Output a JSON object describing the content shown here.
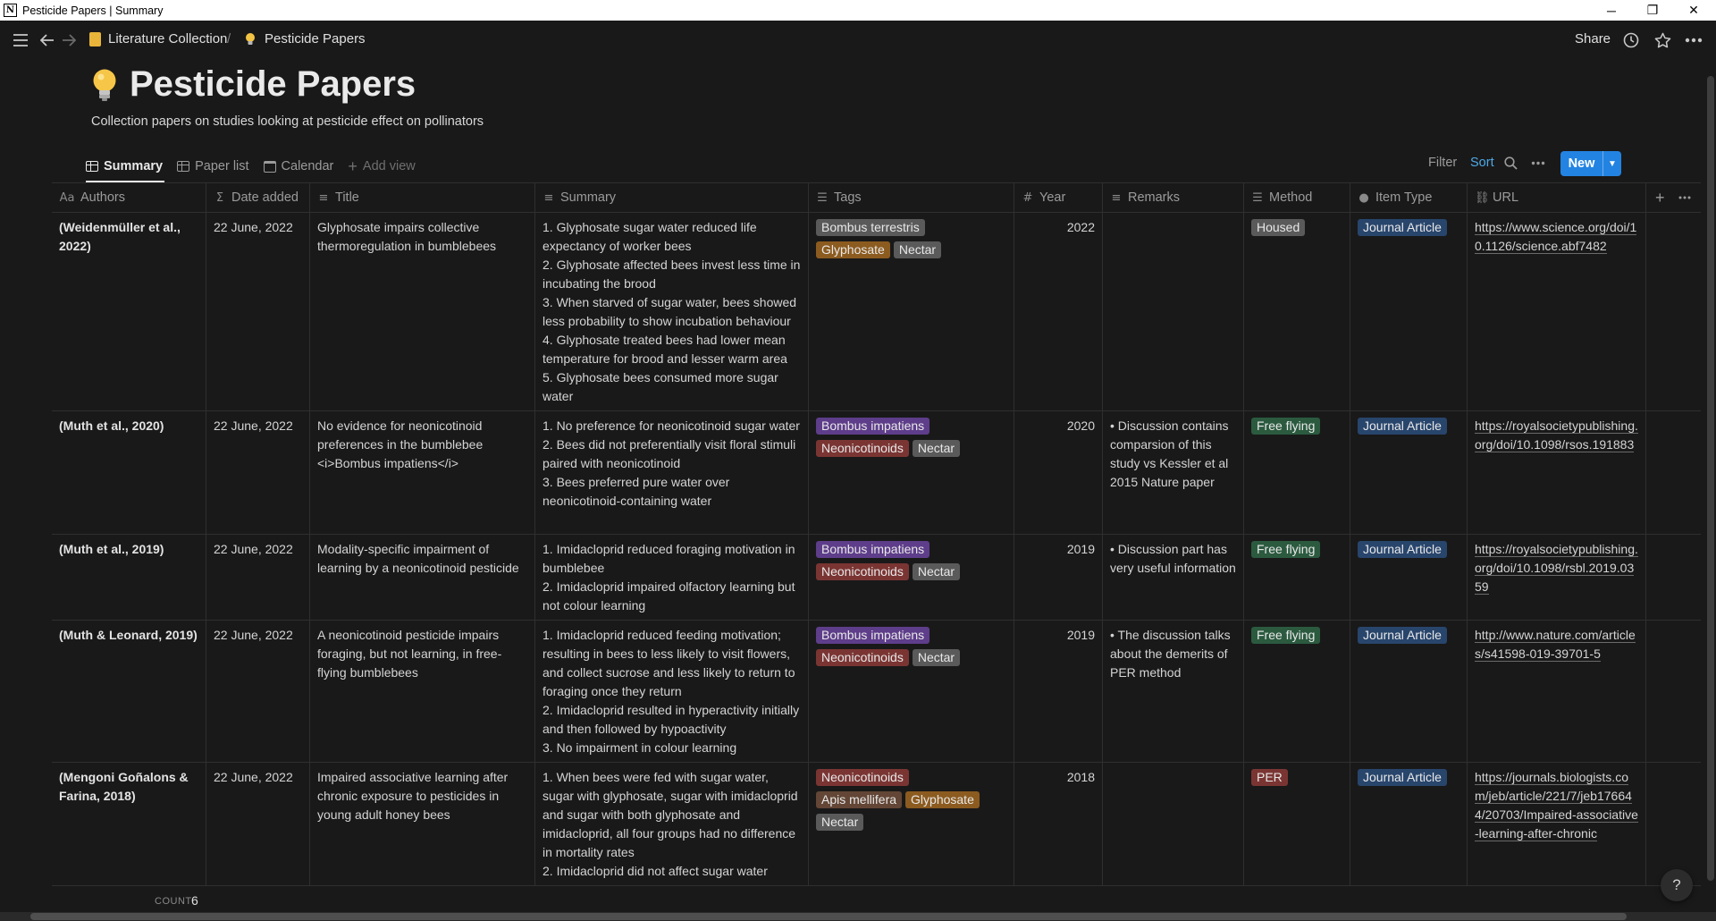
{
  "window": {
    "title": "Pesticide Papers | Summary",
    "app_logo": "N"
  },
  "breadcrumb": {
    "parent": "Literature Collection",
    "separator": "/",
    "current": "Pesticide Papers"
  },
  "topbar": {
    "share_label": "Share"
  },
  "page": {
    "title": "Pesticide Papers",
    "description": "Collection papers on studies looking at pesticide effect on pollinators"
  },
  "views": {
    "tabs": [
      {
        "label": "Summary",
        "icon": "table-icon",
        "active": true
      },
      {
        "label": "Paper list",
        "icon": "table-icon",
        "active": false
      },
      {
        "label": "Calendar",
        "icon": "calendar-icon",
        "active": false
      }
    ],
    "add_view_label": "Add view"
  },
  "toolbar": {
    "filter_label": "Filter",
    "sort_label": "Sort",
    "new_label": "New"
  },
  "columns": [
    {
      "label": "Authors",
      "icon": "Aa"
    },
    {
      "label": "Date added",
      "icon": "Σ"
    },
    {
      "label": "Title",
      "icon": "≡"
    },
    {
      "label": "Summary",
      "icon": "≡"
    },
    {
      "label": "Tags",
      "icon": "☰"
    },
    {
      "label": "Year",
      "icon": "#"
    },
    {
      "label": "Remarks",
      "icon": "≡"
    },
    {
      "label": "Method",
      "icon": "☰"
    },
    {
      "label": "Item Type",
      "icon": "●"
    },
    {
      "label": "URL",
      "icon": "⛓"
    }
  ],
  "tag_colors": {
    "gray": "#5a5a5a",
    "orange": "#8c5b1f",
    "purple": "#5e3d8a",
    "red": "#7a3533",
    "green": "#2b5a3f",
    "blue": "#28456c",
    "brown": "#634636"
  },
  "rows": [
    {
      "authors": "(Weidenmüller et al., 2022)",
      "date": "22 June, 2022",
      "title": "Glyphosate impairs collective thermoregulation in bumblebees",
      "summary": [
        "1. Glyphosate sugar water reduced life expectancy of worker bees",
        "2. Glyphosate affected bees invest less time in incubating the brood",
        "3. When starved of sugar water, bees showed less probability to show incubation behaviour",
        "4. Glyphosate treated bees had lower mean temperature for brood and lesser warm area",
        "5. Glyphosate bees consumed more sugar water"
      ],
      "tags": [
        {
          "label": "Bombus terrestris",
          "color": "gray"
        },
        {
          "label": "Glyphosate",
          "color": "orange"
        },
        {
          "label": "Nectar",
          "color": "gray"
        }
      ],
      "year": "2022",
      "remarks": "",
      "method": {
        "label": "Housed",
        "color": "gray"
      },
      "item_type": {
        "label": "Journal Article",
        "color": "blue"
      },
      "url": "https://www.science.org/doi/10.1126/science.abf7482"
    },
    {
      "authors": "(Muth et al., 2020)",
      "date": "22 June, 2022",
      "title": "No evidence for neonicotinoid preferences in the bumblebee <i>Bombus impatiens</i>",
      "summary": [
        "1. No preference for neonicotinoid sugar water",
        "2. Bees did not preferentially visit floral stimuli paired with neonicotinoid",
        "3. Bees preferred pure water over neonicotinoid-containing water"
      ],
      "tags": [
        {
          "label": "Bombus impatiens",
          "color": "purple"
        },
        {
          "label": "Neonicotinoids",
          "color": "red"
        },
        {
          "label": "Nectar",
          "color": "gray"
        }
      ],
      "year": "2020",
      "remarks": "• Discussion contains comparsion of this study vs Kessler et al 2015 Nature paper",
      "method": {
        "label": "Free flying",
        "color": "green"
      },
      "item_type": {
        "label": "Journal Article",
        "color": "blue"
      },
      "url": "https://royalsocietypublishing.org/doi/10.1098/rsos.191883"
    },
    {
      "authors": "(Muth et al., 2019)",
      "date": "22 June, 2022",
      "title": "Modality-specific impairment of learning by a neonicotinoid pesticide",
      "summary": [
        "1. Imidacloprid reduced foraging motivation in bumblebee",
        "2. Imidacloprid impaired olfactory learning but not colour learning"
      ],
      "tags": [
        {
          "label": "Bombus impatiens",
          "color": "purple"
        },
        {
          "label": "Neonicotinoids",
          "color": "red"
        },
        {
          "label": "Nectar",
          "color": "gray"
        }
      ],
      "year": "2019",
      "remarks": "• Discussion part has very useful information",
      "method": {
        "label": "Free flying",
        "color": "green"
      },
      "item_type": {
        "label": "Journal Article",
        "color": "blue"
      },
      "url": "https://royalsocietypublishing.org/doi/10.1098/rsbl.2019.0359"
    },
    {
      "authors": "(Muth & Leonard, 2019)",
      "date": "22 June, 2022",
      "title": "A neonicotinoid pesticide impairs foraging, but not learning, in free-flying bumblebees",
      "summary": [
        "1. Imidacloprid reduced feeding motivation; resulting in bees to less likely to visit flowers, and collect sucrose and less likely to return to foraging once they return",
        "2. Imidacloprid resulted in hyperactivity initially and then followed by hypoactivity",
        "3. No impairment in colour learning"
      ],
      "tags": [
        {
          "label": "Bombus impatiens",
          "color": "purple"
        },
        {
          "label": "Neonicotinoids",
          "color": "red"
        },
        {
          "label": "Nectar",
          "color": "gray"
        }
      ],
      "year": "2019",
      "remarks": "• The discussion talks about the demerits of PER method",
      "method": {
        "label": "Free flying",
        "color": "green"
      },
      "item_type": {
        "label": "Journal Article",
        "color": "blue"
      },
      "url": "http://www.nature.com/articles/s41598-019-39701-5"
    },
    {
      "authors": "(Mengoni Goñalons & Farina, 2018)",
      "date": "22 June, 2022",
      "title": "Impaired associative learning after chronic exposure to pesticides in young adult honey bees",
      "summary": [
        "1. When bees were fed with sugar water, sugar with glyphosate, sugar with imidacloprid and sugar with both glyphosate and imidacloprid, all four groups had no difference in mortality rates",
        "2. Imidacloprid did not affect sugar water"
      ],
      "tags": [
        {
          "label": "Neonicotinoids",
          "color": "red"
        },
        {
          "label": "Apis mellifera",
          "color": "brown"
        },
        {
          "label": "Glyphosate",
          "color": "orange"
        },
        {
          "label": "Nectar",
          "color": "gray"
        }
      ],
      "year": "2018",
      "remarks": "",
      "method": {
        "label": "PER",
        "color": "red"
      },
      "item_type": {
        "label": "Journal Article",
        "color": "blue"
      },
      "url": "https://journals.biologists.com/jeb/article/221/7/jeb176644/20703/Impaired-associative-learning-after-chronic"
    }
  ],
  "footer": {
    "count_label": "COUNT",
    "count_value": "6"
  },
  "help_label": "?"
}
